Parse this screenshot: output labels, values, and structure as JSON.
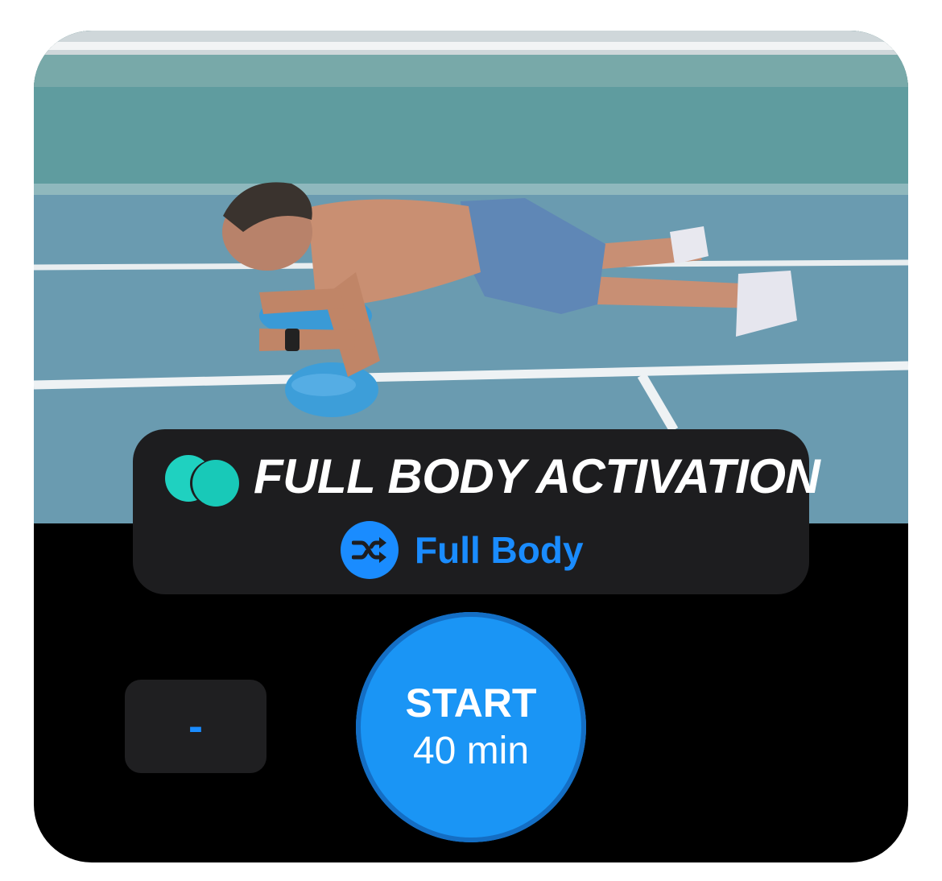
{
  "workout": {
    "title": "FULL BODY ACTIVATION",
    "category": "Full Body",
    "category_icon": "shuffle-icon",
    "logo_icon": "two-circles-logo-icon",
    "photo": "man-doing-forearm-plank-on-balance-balls"
  },
  "controls": {
    "minus_label": "-",
    "start_label": "START",
    "duration_label": "40 min"
  },
  "colors": {
    "accent": "#1a8cff",
    "start_button": "#1a95f5",
    "logo": "#1fd1c0",
    "card_background": "#000000",
    "pill_background": "#1d1d1f"
  }
}
